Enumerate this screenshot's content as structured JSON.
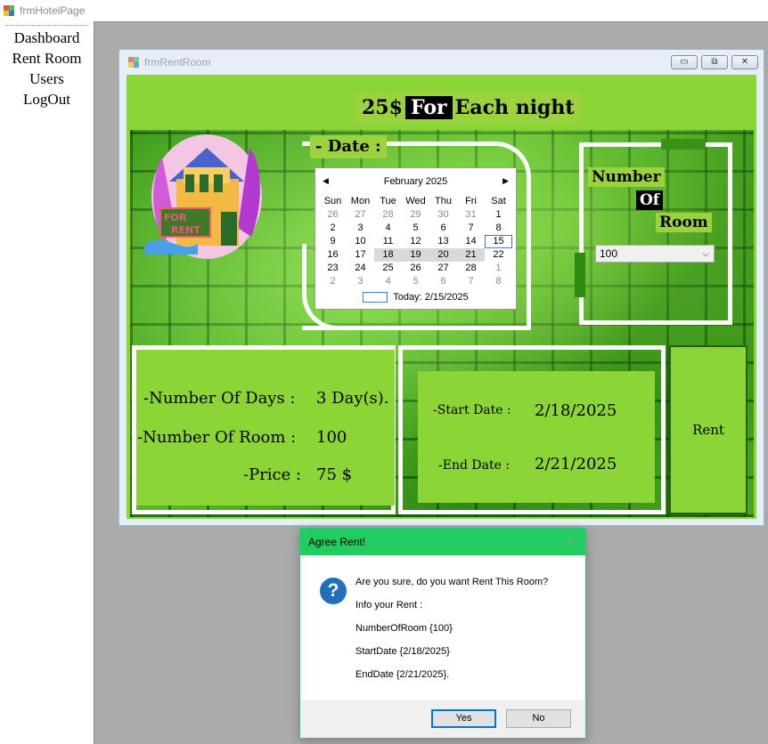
{
  "outer_window": {
    "title": "frmHotelPage"
  },
  "left_menu": {
    "items": [
      "Dashboard",
      "Rent Room",
      "Users",
      "LogOut"
    ]
  },
  "child_window": {
    "title": "frmRentRoom",
    "buttons": {
      "minimize": "▭",
      "restore": "⧉",
      "close": "✕"
    }
  },
  "heading": {
    "part1": "25$",
    "highlight": "For",
    "part2": "Each night"
  },
  "house_image": {
    "sign_line1": "FOR",
    "sign_line2": "RENT"
  },
  "date_section": {
    "label": "- Date :"
  },
  "calendar": {
    "month_year": "February 2025",
    "weekdays": [
      "Sun",
      "Mon",
      "Tue",
      "Wed",
      "Thu",
      "Fri",
      "Sat"
    ],
    "weeks": [
      [
        "26",
        "27",
        "28",
        "29",
        "30",
        "31",
        "1"
      ],
      [
        "2",
        "3",
        "4",
        "5",
        "6",
        "7",
        "8"
      ],
      [
        "9",
        "10",
        "11",
        "12",
        "13",
        "14",
        "15"
      ],
      [
        "16",
        "17",
        "18",
        "19",
        "20",
        "21",
        "22"
      ],
      [
        "23",
        "24",
        "25",
        "26",
        "27",
        "28",
        "1"
      ],
      [
        "2",
        "3",
        "4",
        "5",
        "6",
        "7",
        "8"
      ]
    ],
    "today_label": "Today: 2/15/2025"
  },
  "room_section": {
    "word1": "Number",
    "word2": "Of",
    "word3": "Room",
    "selected_value": "100"
  },
  "info_panel": {
    "days_label": "-Number Of Days :",
    "days_value": "3 Day(s).",
    "room_label": "-Number Of Room :",
    "room_value": "100",
    "price_label": "-Price :",
    "price_value": "75 $"
  },
  "dates_panel": {
    "start_label": "-Start Date :",
    "start_value": "2/18/2025",
    "end_label": "-End Date :",
    "end_value": "2/21/2025"
  },
  "rent_button": {
    "label": "Rent"
  },
  "dialog": {
    "title": "Agree Rent!",
    "close": "✕",
    "icon": "?",
    "lines": [
      "Are you sure, do you want Rent This Room?",
      "Info your Rent :",
      "NumberOfRoom {100}",
      "StartDate {2/18/2025}",
      "EndDate {2/21/2025}."
    ],
    "yes_label": "Yes",
    "no_label": "No"
  }
}
